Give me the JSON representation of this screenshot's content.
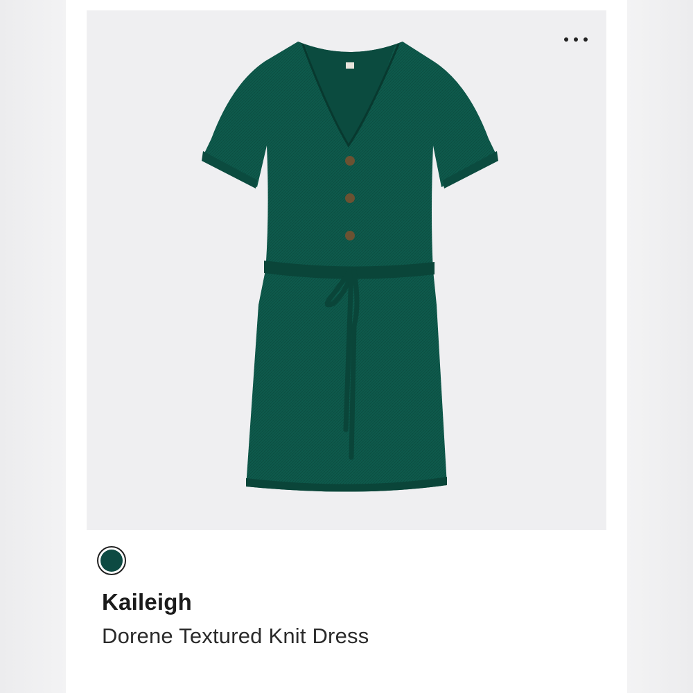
{
  "product": {
    "brand": "Kaileigh",
    "name": "Dorene Textured Knit Dress",
    "image_icon": "dress-photo",
    "selected_color": "#0d4a42"
  },
  "actions": {
    "more_icon": "more-horizontal-icon"
  },
  "colors": {
    "dress": "#0e5a4c",
    "dress_shadow": "#0a4539",
    "button": "#6b5232",
    "photo_bg": "#efeff1"
  }
}
